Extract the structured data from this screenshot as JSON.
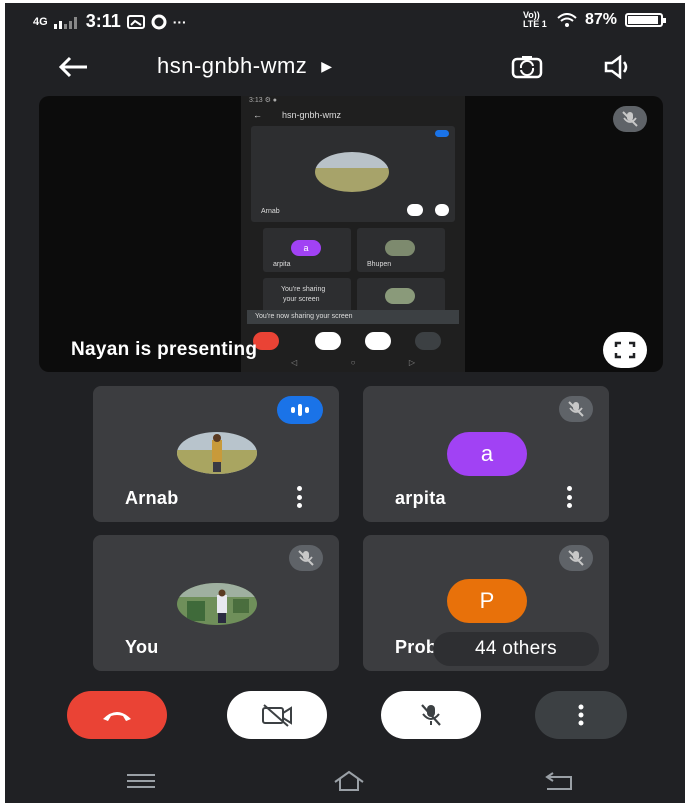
{
  "status_bar": {
    "network": "4G",
    "time": "3:11",
    "lte": "Vo)) LTE 1",
    "battery": "87%",
    "battery_level": 0.87
  },
  "app_bar": {
    "meeting_code": "hsn-gnbh-wmz"
  },
  "presentation": {
    "label": "Nayan is presenting",
    "shared_screen": {
      "meeting_code": "hsn-gnbh-wmz",
      "main_name": "Arnab",
      "tile1_name": "arpita",
      "tile1_letter": "a",
      "tile2_name": "Bhupen",
      "sharing_line1": "You're sharing",
      "sharing_line2": "your screen",
      "toast": "You're now sharing your screen"
    }
  },
  "participants": [
    {
      "name": "Arnab",
      "type": "photo",
      "speaking": true
    },
    {
      "name": "arpita",
      "type": "letter",
      "letter": "a",
      "color": "#a142f4",
      "muted": true
    },
    {
      "name": "You",
      "type": "photo",
      "muted": true
    },
    {
      "name": "Prob",
      "type": "letter",
      "letter": "P",
      "color": "#e8710a",
      "muted": true
    }
  ],
  "others_chip": "44 others",
  "colors": {
    "background": "#202124",
    "tile": "#3c3d40",
    "end_call": "#ea4335",
    "speaking": "#1a73e8"
  },
  "icons": [
    "back-arrow-icon",
    "switch-camera-icon",
    "speaker-icon",
    "mic-off-icon",
    "fullscreen-icon",
    "end-call-icon",
    "camera-off-icon",
    "more-vert-icon"
  ]
}
